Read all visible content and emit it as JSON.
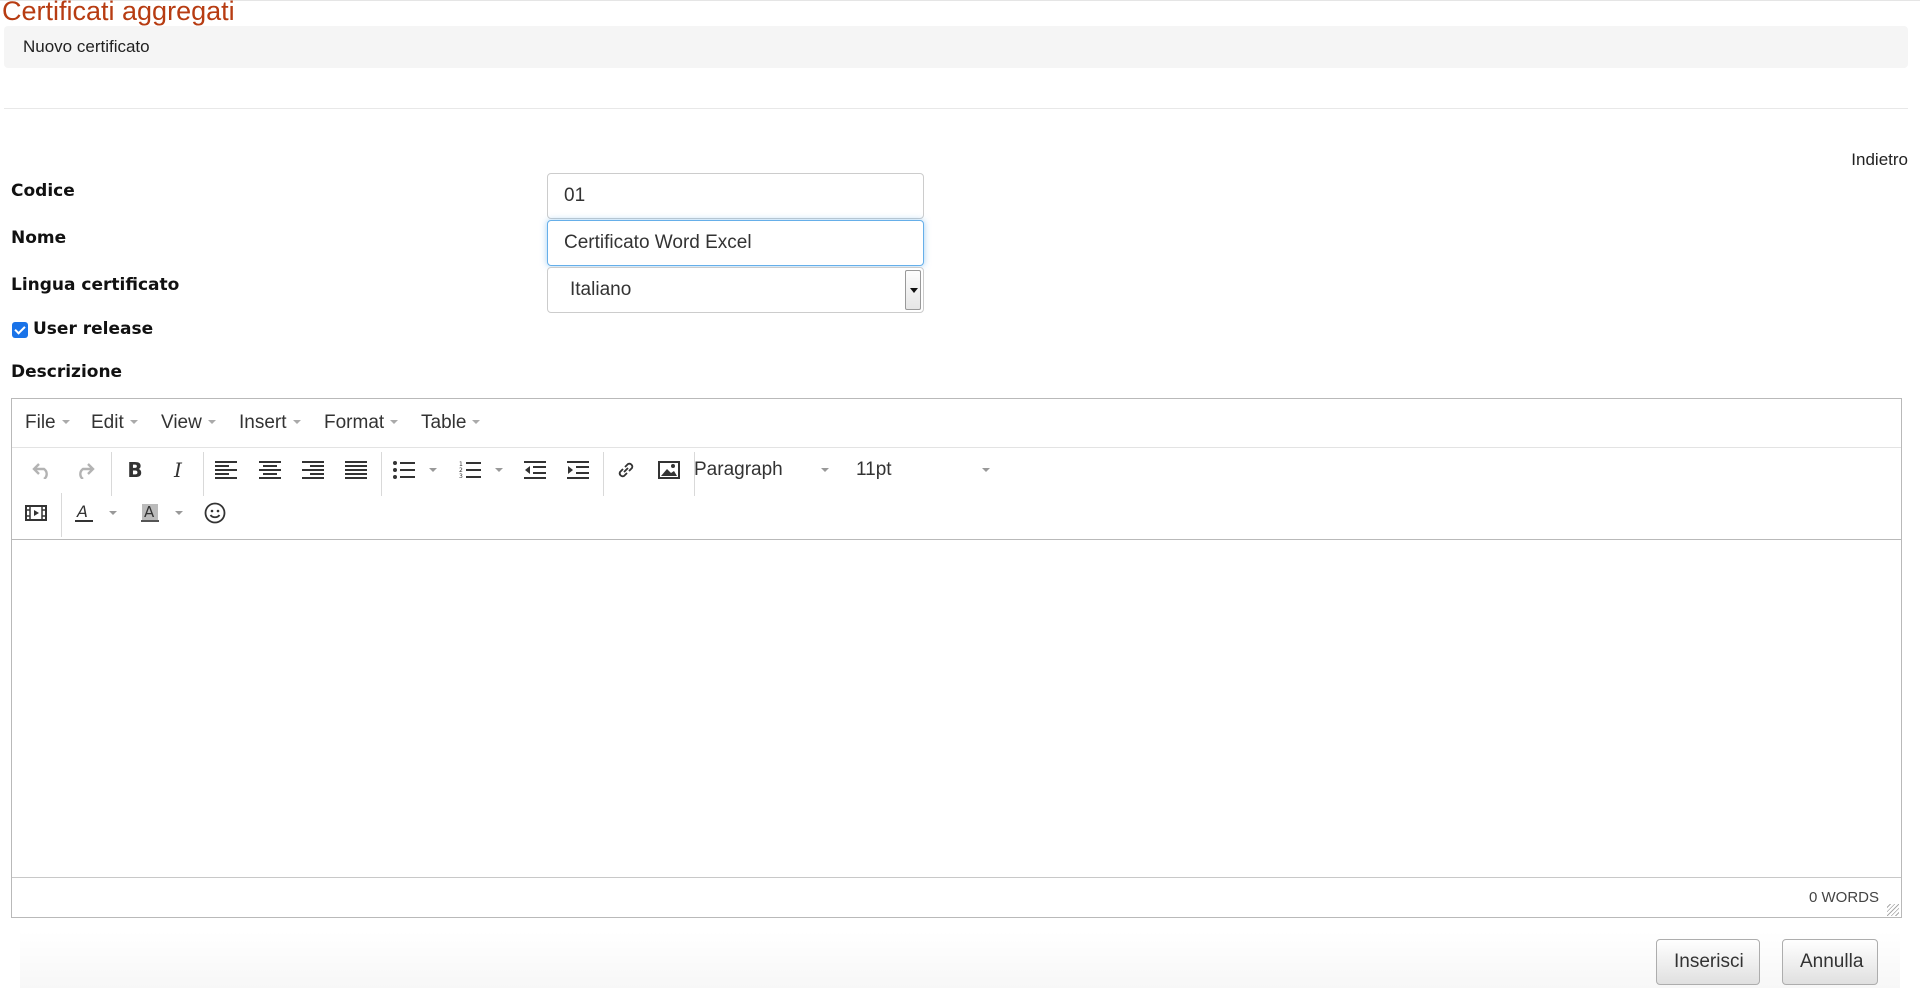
{
  "page": {
    "title": "Certificati aggregati",
    "breadcrumb": "Nuovo certificato",
    "back_link": "Indietro"
  },
  "form": {
    "codice_label": "Codice",
    "codice_value": "01",
    "nome_label": "Nome",
    "nome_value": "Certificato Word Excel",
    "lingua_label": "Lingua certificato",
    "lingua_value": "Italiano",
    "user_release_label": "User release",
    "user_release_checked": true,
    "descrizione_label": "Descrizione"
  },
  "editor": {
    "menu": [
      "File",
      "Edit",
      "View",
      "Insert",
      "Format",
      "Table"
    ],
    "block_format": "Paragraph",
    "font_size": "11pt",
    "word_count": "0 WORDS"
  },
  "buttons": {
    "insert": "Inserisci",
    "cancel": "Annulla"
  },
  "colors": {
    "title": "#b73c12",
    "focus": "#66afe9",
    "checkbox": "#1a73e8"
  }
}
